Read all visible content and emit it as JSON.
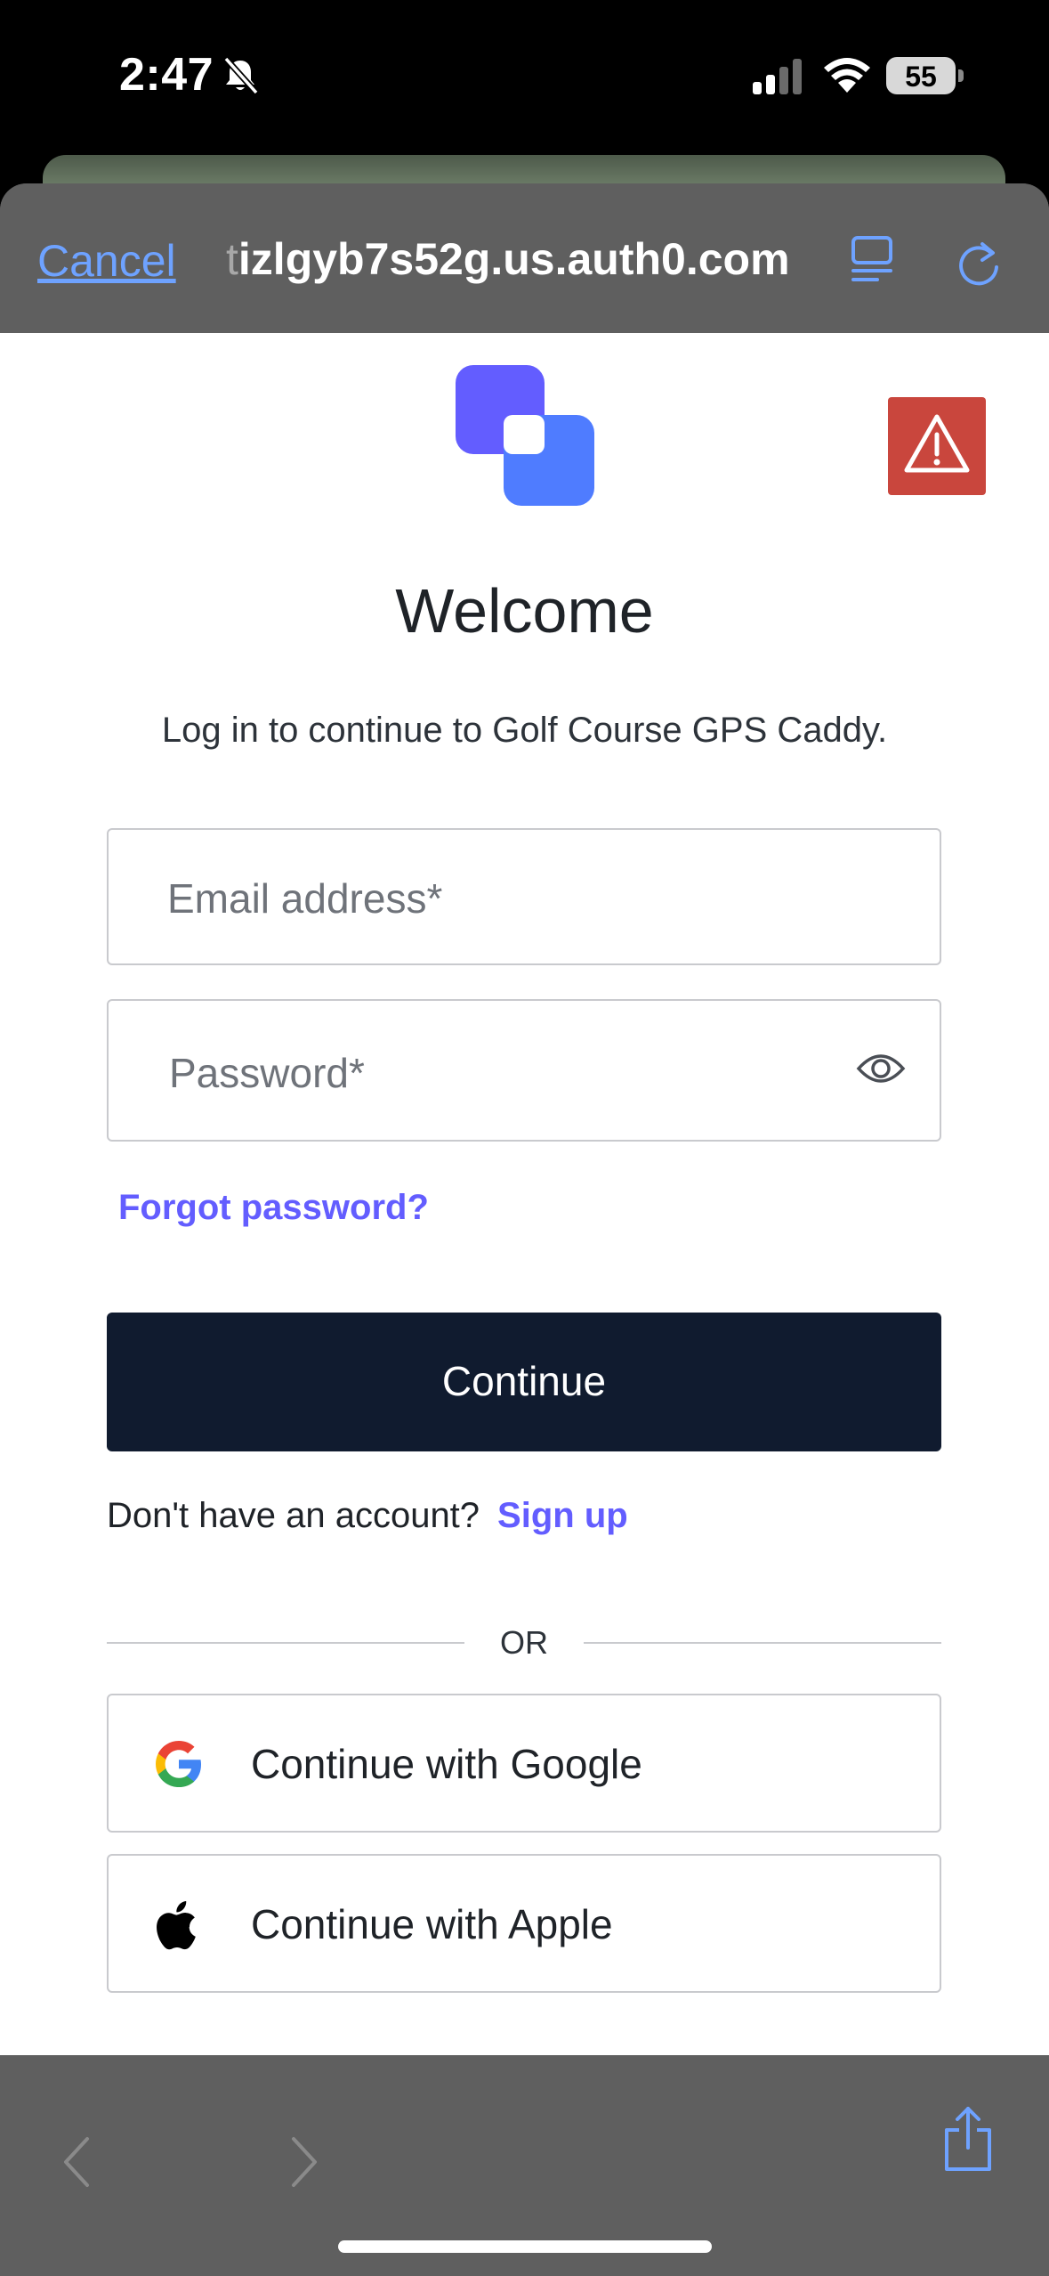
{
  "status_bar": {
    "time": "2:47",
    "battery": "55"
  },
  "toolbar": {
    "cancel_label": "Cancel",
    "url_faded": "t",
    "url": "izlgyb7s52g.us.auth0.com"
  },
  "login": {
    "title": "Welcome",
    "subtitle": "Log in to continue to Golf Course GPS Caddy.",
    "email_placeholder": "Email address*",
    "password_placeholder": "Password*",
    "forgot_label": "Forgot password?",
    "continue_label": "Continue",
    "signup_prompt": "Don't have an account?",
    "signup_link": "Sign up",
    "divider_text": "OR",
    "google_label": "Continue with Google",
    "apple_label": "Continue with Apple"
  },
  "colors": {
    "accent": "#635dff",
    "primary_button": "#101b2f",
    "warning": "#c9463d",
    "safari_link": "#6ea2ff"
  },
  "icons": [
    "bell-slash-icon",
    "signal-icon",
    "wifi-icon",
    "battery-icon",
    "reader-icon",
    "reload-icon",
    "app-logo-icon",
    "warning-icon",
    "eye-icon",
    "google-icon",
    "apple-icon",
    "back-icon",
    "forward-icon",
    "share-icon"
  ]
}
